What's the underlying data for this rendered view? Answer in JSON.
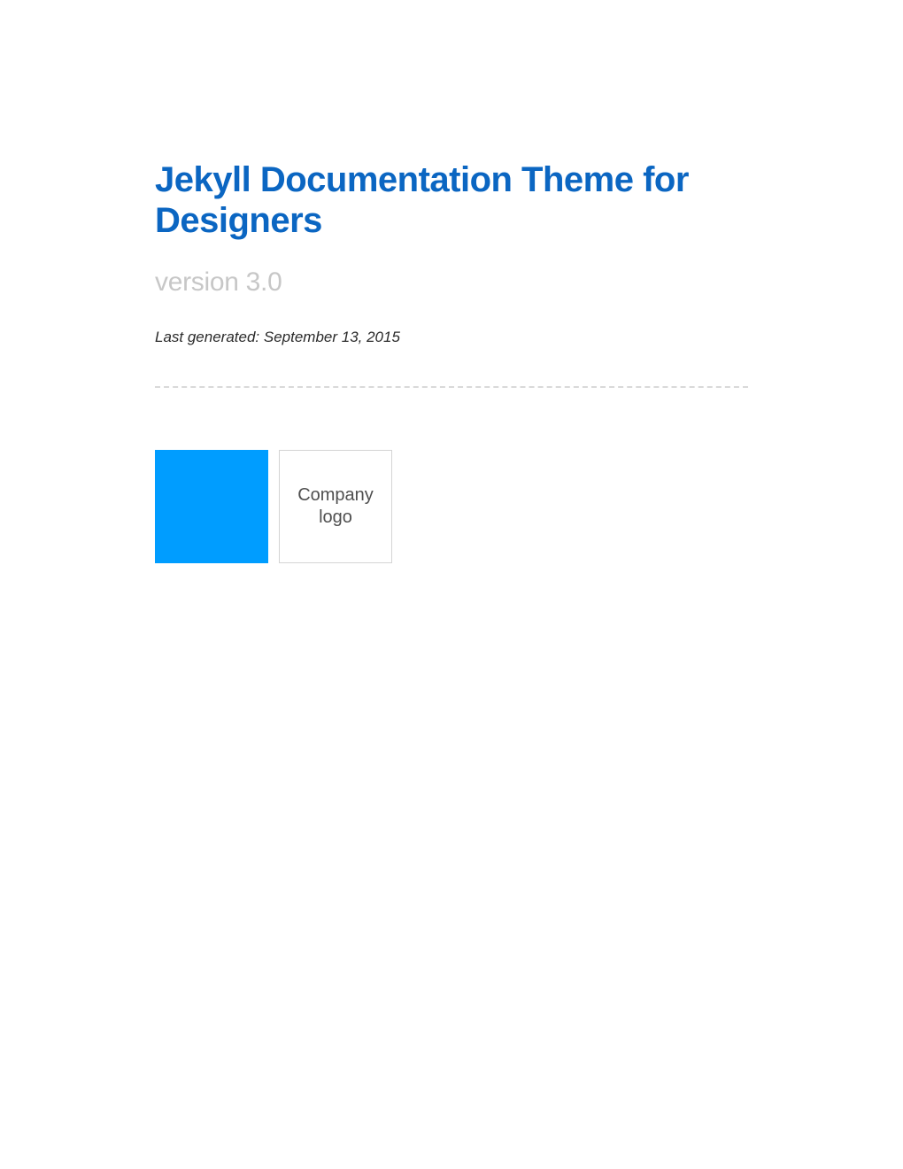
{
  "title": "Jekyll Documentation Theme for Designers",
  "version": "version 3.0",
  "last_generated": "Last generated: September 13, 2015",
  "logo_text": "Company logo"
}
